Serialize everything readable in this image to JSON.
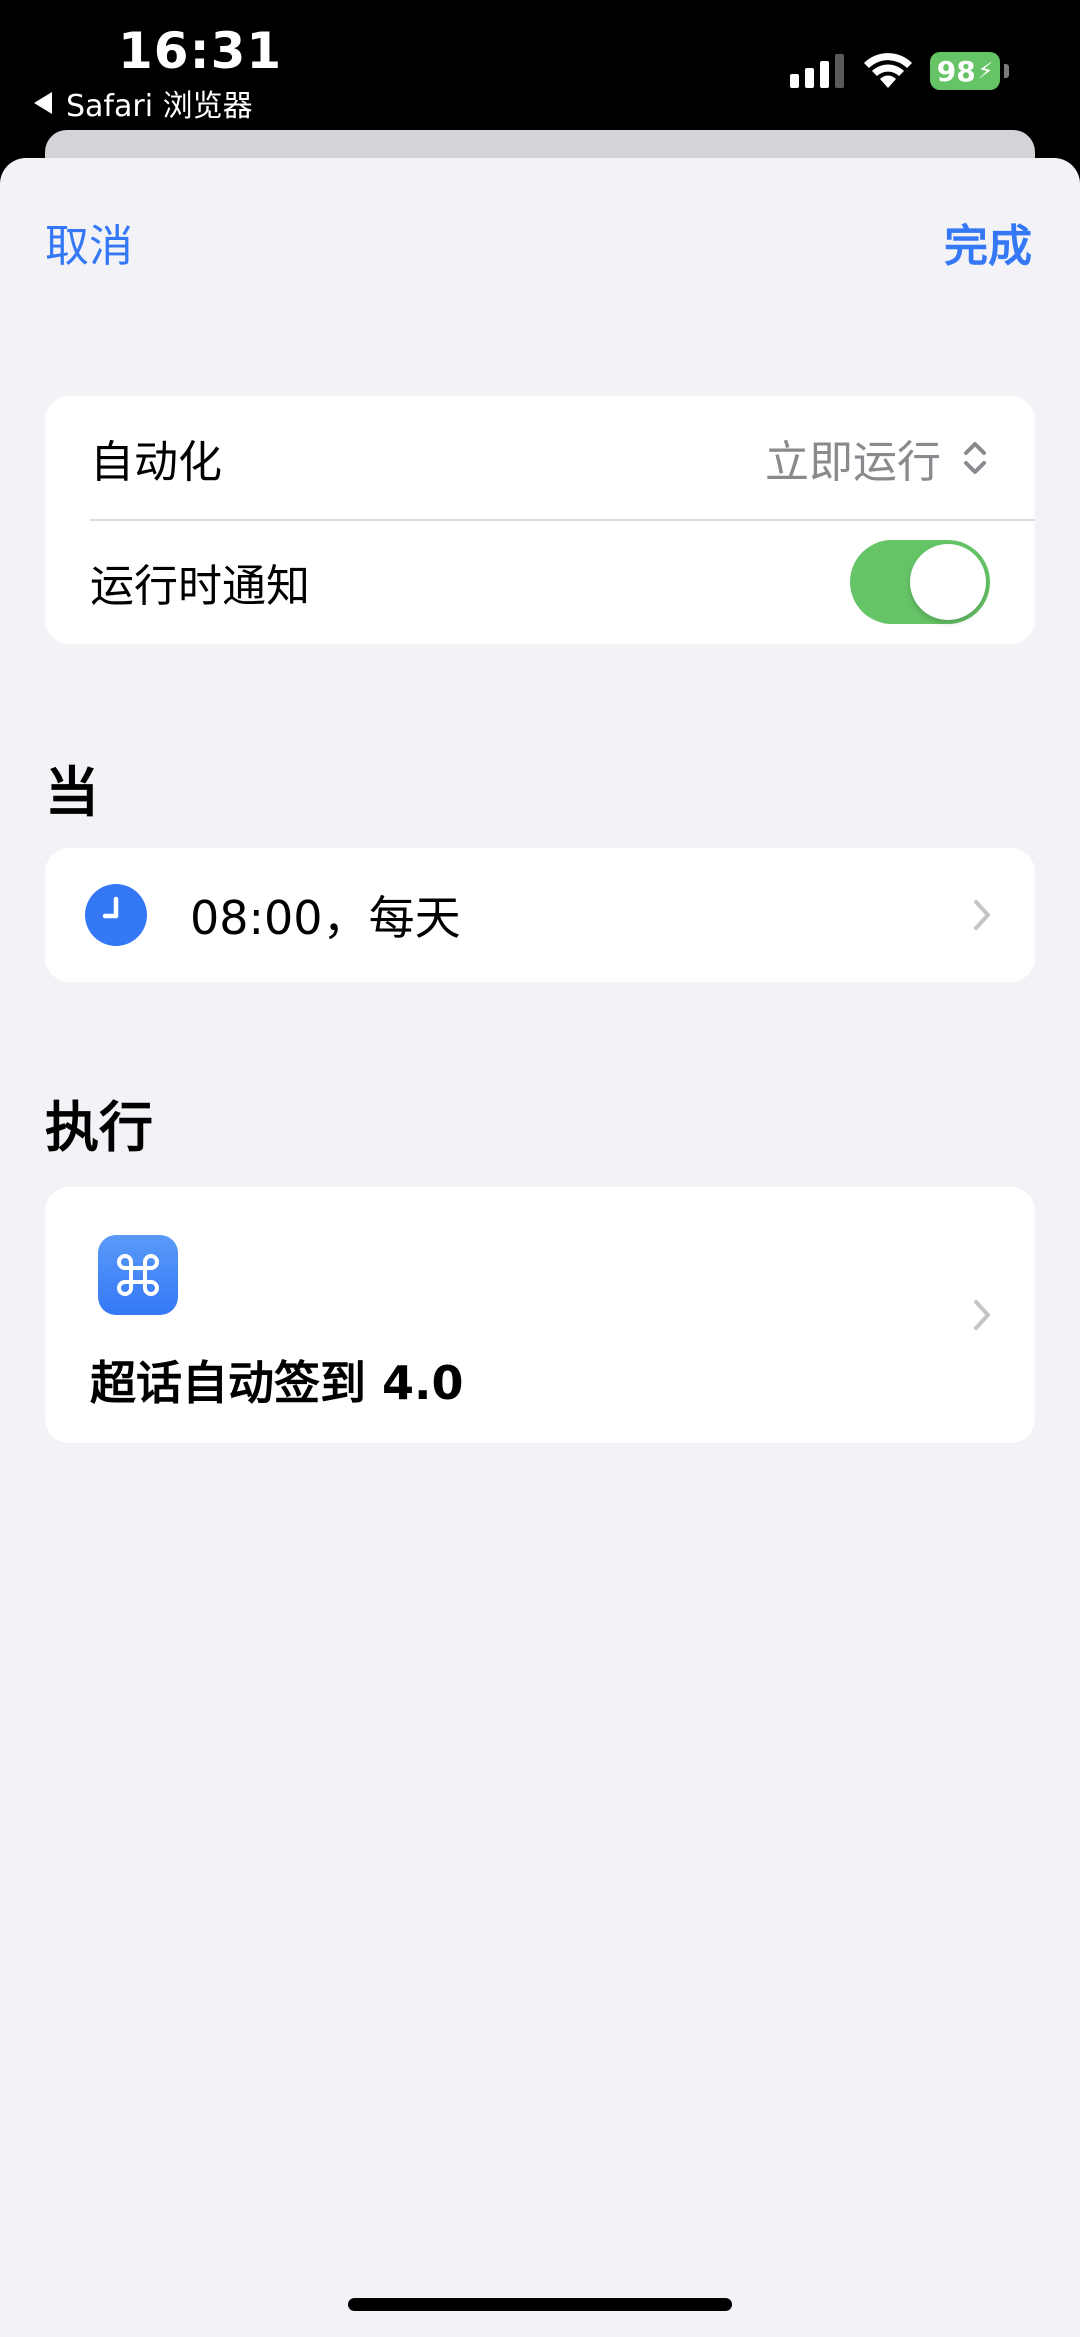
{
  "status_bar": {
    "time": "16:31",
    "back_app": "Safari 浏览器",
    "battery": "98"
  },
  "nav": {
    "cancel": "取消",
    "done": "完成"
  },
  "settings": {
    "automation_label": "自动化",
    "automation_value": "立即运行",
    "notify_label": "运行时通知",
    "notify_on": true
  },
  "when": {
    "header": "当",
    "trigger": "08:00，每天"
  },
  "do": {
    "header": "执行",
    "shortcut_name": "超话自动签到 4.0"
  },
  "colors": {
    "accent": "#3478f6",
    "toggle_on": "#65c466",
    "background": "#f2f2f7"
  }
}
